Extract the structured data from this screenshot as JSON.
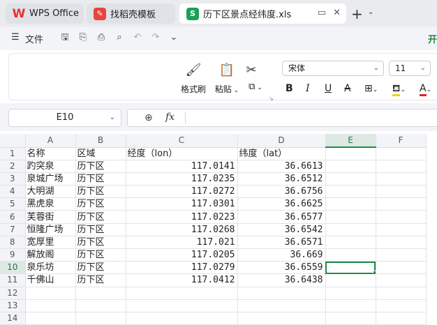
{
  "tabs": [
    {
      "label": "WPS Office",
      "icon": "wps-logo-icon"
    },
    {
      "label": "找稻壳模板",
      "icon": "daoke-icon"
    },
    {
      "label": "历下区景点经纬度.xls",
      "icon": "spreadsheet-icon"
    }
  ],
  "menu": {
    "file_label": "文件",
    "start_tab": "开"
  },
  "ribbon": {
    "format_painter": "格式刷",
    "paste": "粘贴",
    "font_name": "宋体",
    "font_size": "11",
    "bold": "B",
    "italic": "I",
    "underline": "U",
    "strike": "A"
  },
  "formula_bar": {
    "name_box": "E10",
    "fx": "fx",
    "value": ""
  },
  "sheet": {
    "columns": [
      "A",
      "B",
      "C",
      "D",
      "E",
      "F"
    ],
    "selected_column": "E",
    "selected_row": "10",
    "active_cell": "E10",
    "rows": [
      {
        "n": "1",
        "cells": [
          "名称",
          "区域",
          "经度（lon）",
          "纬度（lat）",
          "",
          ""
        ]
      },
      {
        "n": "2",
        "cells": [
          "趵突泉",
          "历下区",
          "117.0141",
          "36.6613",
          "",
          ""
        ]
      },
      {
        "n": "3",
        "cells": [
          "泉城广场",
          "历下区",
          "117.0235",
          "36.6512",
          "",
          ""
        ]
      },
      {
        "n": "4",
        "cells": [
          "大明湖",
          "历下区",
          "117.0272",
          "36.6756",
          "",
          ""
        ]
      },
      {
        "n": "5",
        "cells": [
          "黑虎泉",
          "历下区",
          "117.0301",
          "36.6625",
          "",
          ""
        ]
      },
      {
        "n": "6",
        "cells": [
          "芙蓉街",
          "历下区",
          "117.0223",
          "36.6577",
          "",
          ""
        ]
      },
      {
        "n": "7",
        "cells": [
          "恒隆广场",
          "历下区",
          "117.0268",
          "36.6542",
          "",
          ""
        ]
      },
      {
        "n": "8",
        "cells": [
          "宽厚里",
          "历下区",
          "117.021",
          "36.6571",
          "",
          ""
        ]
      },
      {
        "n": "9",
        "cells": [
          "解放阁",
          "历下区",
          "117.0205",
          "36.669",
          "",
          ""
        ]
      },
      {
        "n": "10",
        "cells": [
          "泉乐坊",
          "历下区",
          "117.0279",
          "36.6559",
          "",
          ""
        ]
      },
      {
        "n": "11",
        "cells": [
          "千佛山",
          "历下区",
          "117.0412",
          "36.6438",
          "",
          ""
        ]
      },
      {
        "n": "12",
        "cells": [
          "",
          "",
          "",
          "",
          "",
          ""
        ]
      },
      {
        "n": "13",
        "cells": [
          "",
          "",
          "",
          "",
          "",
          ""
        ]
      },
      {
        "n": "14",
        "cells": [
          "",
          "",
          "",
          "",
          "",
          ""
        ]
      }
    ]
  },
  "colors": {
    "accent": "#1e8a46",
    "tabbar": "#e9ebef",
    "wps_red": "#e8322d"
  }
}
